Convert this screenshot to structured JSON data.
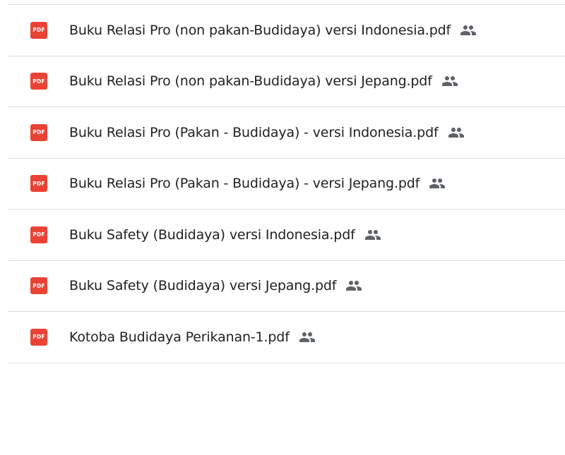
{
  "files": [
    {
      "name": "Buku Relasi Pro (non pakan-Budidaya) versi Indonesia.pdf",
      "icon": "pdf-icon",
      "shared_icon": "people-icon"
    },
    {
      "name": "Buku Relasi Pro (non pakan-Budidaya) versi Jepang.pdf",
      "icon": "pdf-icon",
      "shared_icon": "people-icon"
    },
    {
      "name": "Buku Relasi Pro (Pakan - Budidaya) - versi Indonesia.pdf",
      "icon": "pdf-icon",
      "shared_icon": "people-icon"
    },
    {
      "name": "Buku Relasi Pro (Pakan - Budidaya) - versi Jepang.pdf",
      "icon": "pdf-icon",
      "shared_icon": "people-icon"
    },
    {
      "name": "Buku Safety (Budidaya) versi Indonesia.pdf",
      "icon": "pdf-icon",
      "shared_icon": "people-icon"
    },
    {
      "name": "Buku Safety (Budidaya) versi Jepang.pdf",
      "icon": "pdf-icon",
      "shared_icon": "people-icon"
    },
    {
      "name": "Kotoba Budidaya Perikanan-1.pdf",
      "icon": "pdf-icon",
      "shared_icon": "people-icon"
    }
  ],
  "pdf_icon_label": "PDF",
  "colors": {
    "pdf_red": "#ea4335",
    "text": "#202124",
    "shared_icon": "#5f6368",
    "divider": "#dadce0"
  }
}
